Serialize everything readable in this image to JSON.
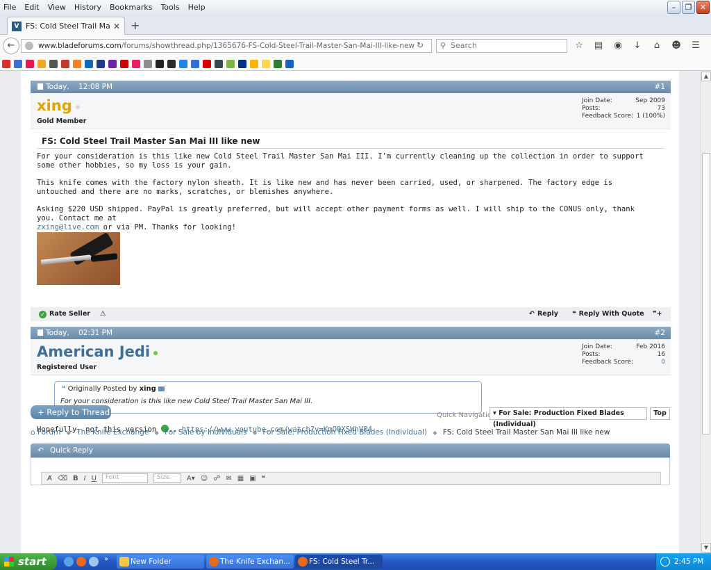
{
  "browser": {
    "menu": [
      "File",
      "Edit",
      "View",
      "History",
      "Bookmarks",
      "Tools",
      "Help"
    ],
    "tab_title": "FS: Cold Steel Trail Mas...",
    "tab_favicon": "V",
    "url_domain": "www.bladeforums.com",
    "url_path": "/forums/showthread.php/1365676-FS-Cold-Steel-Trail-Master-San-Mai-III-like-new",
    "search_placeholder": "Search"
  },
  "bookmark_colors": [
    "#d93025",
    "#3b6fd1",
    "#e8174f",
    "#f6a623",
    "#555555",
    "#c0392b",
    "#f48024",
    "#0e6ab8",
    "#1e3a8a",
    "#6b21a8",
    "#cc0000",
    "#e91e63",
    "#8e8e8e",
    "#222222",
    "#2b2b2b",
    "#1e88e5",
    "#2f6fdc",
    "#d50000",
    "#37474f",
    "#7cb342",
    "#003087",
    "#ffb300",
    "#ffd54f",
    "#2e7d32",
    "#1565c0"
  ],
  "posts": [
    {
      "date": "Today,",
      "time": "12:08 PM",
      "number": "#1",
      "username": "xing",
      "user_color": "#e0a400",
      "status_dot": "#d9d9d9",
      "user_title": "Gold Member",
      "stats": [
        {
          "label": "Join Date:",
          "value": "Sep 2009"
        },
        {
          "label": "Posts:",
          "value": "73"
        },
        {
          "label": "Feedback Score:",
          "value": "1 (100%)"
        }
      ],
      "title": "FS: Cold Steel Trail Master San Mai III like new",
      "paragraphs": [
        "For your consideration is this like new Cold Steel Trail Master San Mai III. I'm currently cleaning up the collection in order to support some other hobbies, so my loss is your gain.",
        "This knife comes with the factory nylon sheath. It is like new and has never been carried, used, or sharpened. The factory edge is untouched and there are no marks, scratches, or blemishes anywhere."
      ],
      "last_para_lead": "Asking $220 USD shipped. PayPal is greatly preferred, but will accept other payment forms as well. I will ship to the CONUS only, thank you. Contact me at",
      "email": "zxing@live.com",
      "last_para_tail": " or via PM. Thanks for looking!",
      "rate_seller": "Rate Seller"
    },
    {
      "date": "Today,",
      "time": "02:31 PM",
      "number": "#2",
      "username": "American Jedi",
      "user_color": "#3d6f99",
      "status_dot": "#7cc142",
      "user_title": "Registered User",
      "stats": [
        {
          "label": "Join Date:",
          "value": "Feb 2016"
        },
        {
          "label": "Posts:",
          "value": "16"
        },
        {
          "label": "Feedback Score:",
          "value": "0"
        }
      ],
      "quote_prefix": "Originally Posted by",
      "quote_author": "xing",
      "quote_text": "For your consideration is this like new Cold Steel Trail Master San Mai III.",
      "reply_lead": "Hopefully, not this version",
      "reply_ellipsis": "...",
      "reply_link": "https://www.youtube.com/watch?v=KmO0XSWhV04"
    }
  ],
  "actions": {
    "reply": "Reply",
    "reply_with_quote": "Reply With Quote"
  },
  "thread": {
    "reply_button": "+ Reply to Thread",
    "quick_nav_label": "Quick Navigation",
    "quick_nav_value": "For Sale: Production Fixed Blades (Individual)",
    "top_button": "Top",
    "breadcrumbs": [
      "Forum",
      "The Knife Exchange",
      "For Sale by Individuals",
      "For Sale: Production Fixed Blades (Individual)"
    ],
    "breadcrumb_current": "FS: Cold Steel Trail Master San Mai III like new",
    "quick_reply": "Quick Reply",
    "font_placeholder": "Font",
    "size_placeholder": "Size"
  },
  "taskbar": {
    "start": "start",
    "tasks": [
      "New Folder",
      "The Knife Exchan...",
      "FS: Cold Steel Tr..."
    ],
    "clock": "2:45 PM"
  }
}
